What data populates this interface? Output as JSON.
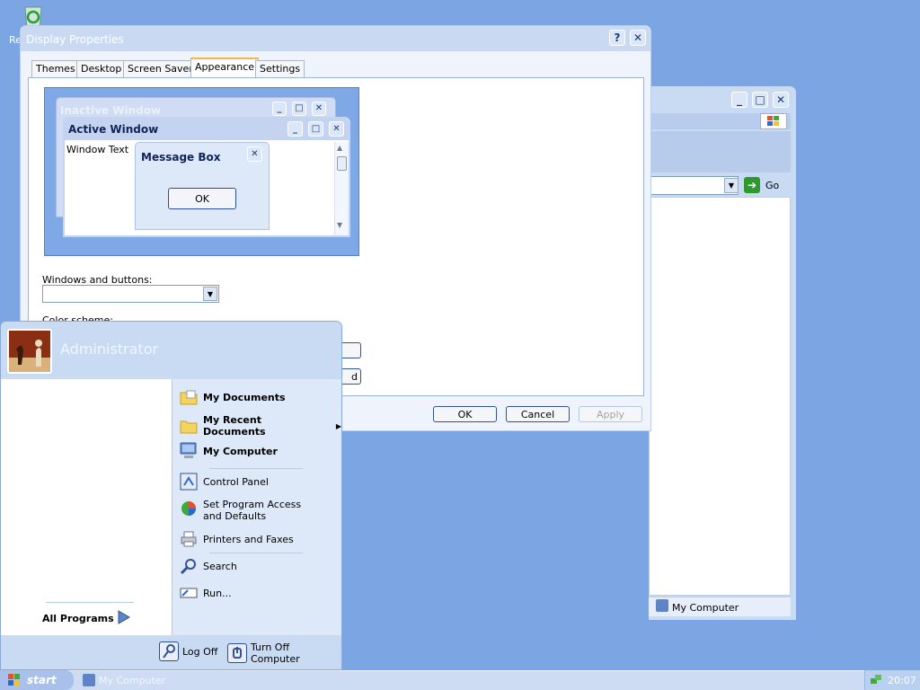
{
  "desktop": {
    "recycle_label": "Re"
  },
  "explorer": {
    "go_label": "Go",
    "status_text": "My Computer"
  },
  "dialog": {
    "title": "Display Properties",
    "tabs": [
      "Themes",
      "Desktop",
      "Screen Saver",
      "Appearance",
      "Settings"
    ],
    "active_tab": "Appearance",
    "preview": {
      "inactive_title": "Inactive Window",
      "active_title": "Active Window",
      "window_text": "Window Text",
      "msgbox_title": "Message Box",
      "msgbox_ok": "OK"
    },
    "windows_buttons_label": "Windows and buttons:",
    "windows_buttons_value": "",
    "color_scheme_label": "Color scheme:",
    "partial_button_text": "d",
    "buttons": {
      "ok": "OK",
      "cancel": "Cancel",
      "apply": "Apply"
    }
  },
  "start_menu": {
    "user": "Administrator",
    "items": [
      {
        "label": "My Documents",
        "bold": true,
        "icon": "folder-documents-icon"
      },
      {
        "label": "My Recent Documents",
        "bold": true,
        "icon": "folder-recent-icon",
        "submenu": true
      },
      {
        "label": "My Computer",
        "bold": true,
        "icon": "computer-icon"
      },
      {
        "label": "Control Panel",
        "bold": false,
        "icon": "control-panel-icon"
      },
      {
        "label": "Set Program Access and Defaults",
        "bold": false,
        "icon": "program-access-icon"
      },
      {
        "label": "Printers and Faxes",
        "bold": false,
        "icon": "printer-icon"
      },
      {
        "label": "Search",
        "bold": false,
        "icon": "search-icon"
      },
      {
        "label": "Run...",
        "bold": false,
        "icon": "run-icon"
      }
    ],
    "all_programs": "All Programs",
    "log_off": "Log Off",
    "turn_off": "Turn Off Computer"
  },
  "taskbar": {
    "start_label": "start",
    "task_item": "My Computer",
    "clock": "20:07"
  }
}
